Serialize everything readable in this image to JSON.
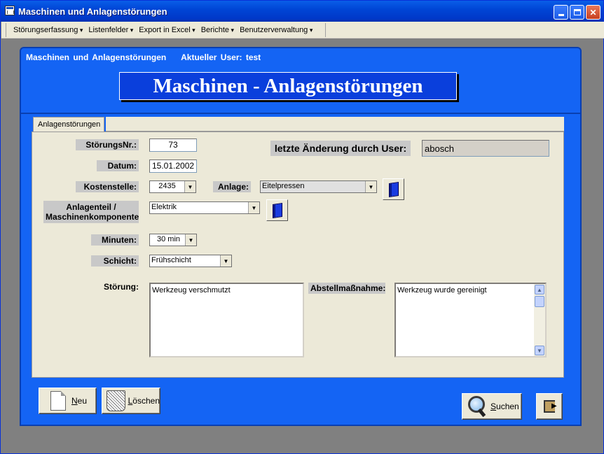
{
  "window": {
    "title": "Maschinen und Anlagenstörungen"
  },
  "menu": {
    "items": [
      {
        "label": "Störungserfassung"
      },
      {
        "label": "Listenfelder"
      },
      {
        "label": "Export in Excel"
      },
      {
        "label": "Berichte"
      },
      {
        "label": "Benutzerverwaltung"
      }
    ]
  },
  "form": {
    "header_left": "Maschinen und Anlagenstörungen",
    "header_user": "Aktueller User: test",
    "banner_title": "Maschinen - Anlagenstörungen"
  },
  "tabs": [
    {
      "label": "Anlagenstörungen",
      "active": true
    }
  ],
  "fields": {
    "stoerungsnr": {
      "label": "StörungsNr.:",
      "value": "73"
    },
    "datum": {
      "label": "Datum:",
      "value": "15.01.2002"
    },
    "kostenstelle": {
      "label": "Kostenstelle:",
      "value": "2435"
    },
    "anlage": {
      "label": "Anlage:",
      "value": "Eitelpressen"
    },
    "anlagenteil": {
      "label_line1": "Anlagenteil /",
      "label_line2": "Maschinenkomponente",
      "value": "Elektrik"
    },
    "minuten": {
      "label": "Minuten:",
      "value": "30 min"
    },
    "schicht": {
      "label": "Schicht:",
      "value": "Frühschicht"
    },
    "letzte_aenderung": {
      "label": "letzte Änderung durch User:",
      "value": "abosch"
    },
    "stoerung": {
      "label": "Störung:",
      "value": "Werkzeug verschmutzt"
    },
    "abstellmassnahme": {
      "label": "Abstellmaßnahme:",
      "value": "Werkzeug wurde gereinigt"
    }
  },
  "buttons": {
    "neu": "Neu",
    "loeschen": "Löschen",
    "suchen": "Suchen"
  },
  "colors": {
    "form_background": "#1464f4",
    "banner_background": "#0a3fdc",
    "panel_background": "#ece9d8",
    "label_background": "#c8c8c8"
  },
  "icons": {
    "window": "app-window-icon",
    "lookup": "book-icon",
    "new": "document-icon",
    "delete": "trash-bin-icon",
    "search": "magnifier-icon",
    "exit": "exit-door-icon"
  }
}
